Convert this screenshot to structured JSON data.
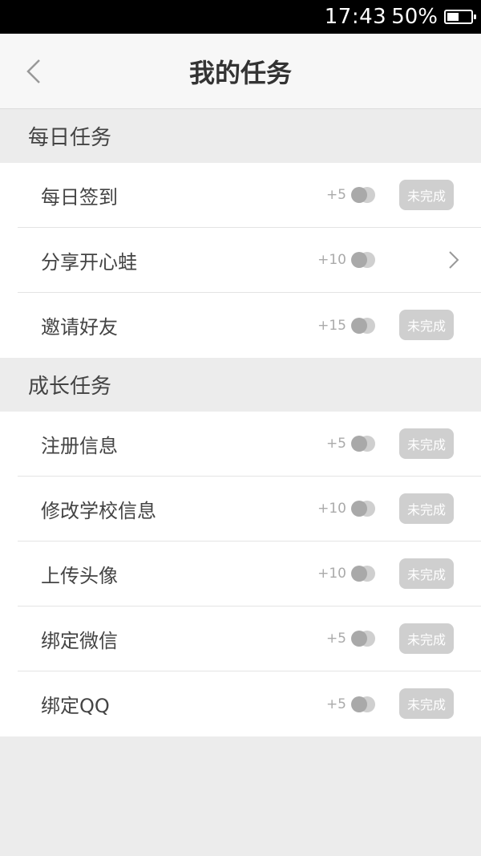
{
  "status_bar": {
    "time": "17:43",
    "battery": "50%"
  },
  "navbar": {
    "title": "我的任务"
  },
  "sections": [
    {
      "title": "每日任务",
      "tasks": [
        {
          "label": "每日签到",
          "reward": "+5",
          "status": "未完成"
        },
        {
          "label": "分享开心蛙",
          "reward": "+10",
          "status": ""
        },
        {
          "label": "邀请好友",
          "reward": "+15",
          "status": "未完成"
        }
      ]
    },
    {
      "title": "成长任务",
      "tasks": [
        {
          "label": "注册信息",
          "reward": "+5",
          "status": "未完成"
        },
        {
          "label": "修改学校信息",
          "reward": "+10",
          "status": "未完成"
        },
        {
          "label": "上传头像",
          "reward": "+10",
          "status": "未完成"
        },
        {
          "label": "绑定微信",
          "reward": "+5",
          "status": "未完成"
        },
        {
          "label": "绑定QQ",
          "reward": "+5",
          "status": "未完成"
        }
      ]
    }
  ]
}
